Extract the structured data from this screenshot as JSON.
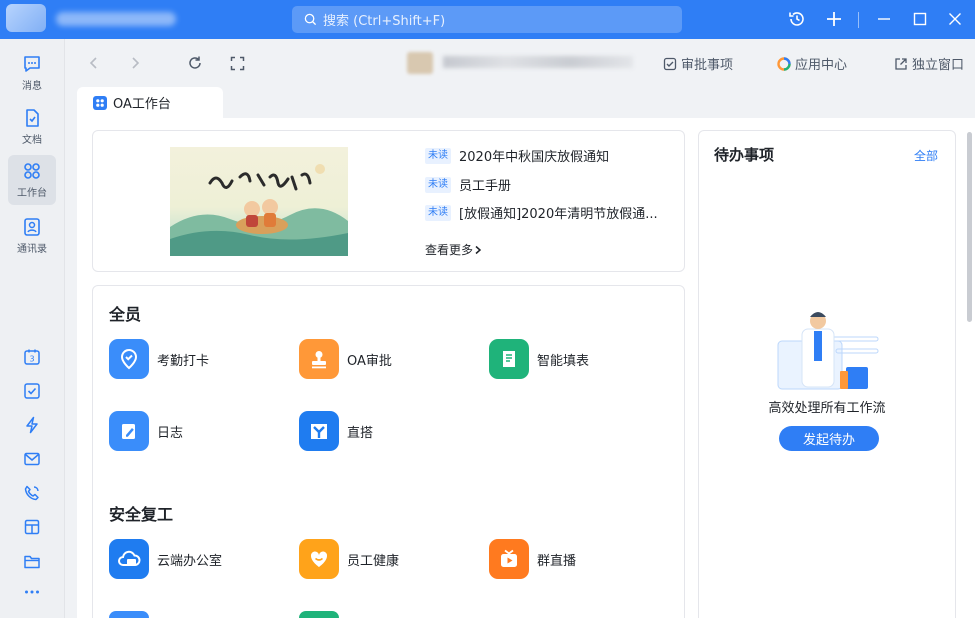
{
  "titlebar": {
    "search_placeholder": "搜索 (Ctrl+Shift+F)",
    "icons": [
      "history-icon",
      "plus-icon",
      "minimize-icon",
      "maximize-icon",
      "close-icon"
    ]
  },
  "rail": {
    "items": [
      {
        "label": "消息",
        "icon": "message-icon"
      },
      {
        "label": "文档",
        "icon": "document-icon"
      },
      {
        "label": "工作台",
        "icon": "workbench-icon",
        "active": true
      },
      {
        "label": "通讯录",
        "icon": "contacts-icon"
      }
    ],
    "bottom_icons": [
      "calendar-icon",
      "todo-check-icon",
      "lightning-icon",
      "mail-icon",
      "phone-icon",
      "box-icon",
      "folder-icon",
      "more-icon"
    ],
    "calendar_day": "3"
  },
  "nav": {
    "links": [
      {
        "label": "审批事项",
        "icon": "approval-check-icon"
      },
      {
        "label": "应用中心",
        "icon": "app-center-icon"
      },
      {
        "label": "独立窗口",
        "icon": "external-window-icon"
      }
    ]
  },
  "tab": {
    "label": "OA工作台"
  },
  "notices": {
    "items": [
      {
        "badge": "未读",
        "title": "2020年中秋国庆放假通知"
      },
      {
        "badge": "未读",
        "title": "员工手册"
      },
      {
        "badge": "未读",
        "title": "[放假通知]2020年清明节放假通..."
      }
    ],
    "more_label": "查看更多"
  },
  "sections": [
    {
      "title": "全员",
      "apps": [
        {
          "label": "考勤打卡",
          "icon": "location-icon",
          "color": "#3a8dfa"
        },
        {
          "label": "OA审批",
          "icon": "stamp-icon",
          "color": "#ff9838"
        },
        {
          "label": "智能填表",
          "icon": "form-icon",
          "color": "#1fb37a"
        },
        {
          "label": "日志",
          "icon": "journal-icon",
          "color": "#3a8dfa"
        },
        {
          "label": "直搭",
          "icon": "builder-icon",
          "color": "#1f7cf0"
        }
      ]
    },
    {
      "title": "安全复工",
      "apps": [
        {
          "label": "云端办公室",
          "icon": "cloud-office-icon",
          "color": "#1f7cf0"
        },
        {
          "label": "员工健康",
          "icon": "heart-icon",
          "color": "#ffa31a"
        },
        {
          "label": "群直播",
          "icon": "live-tv-icon",
          "color": "#ff7a1f"
        }
      ]
    }
  ],
  "todo": {
    "title": "待办事项",
    "all_label": "全部",
    "empty_text": "高效处理所有工作流",
    "button_label": "发起待办"
  },
  "colors": {
    "accent": "#2f7ef5",
    "rail_bg": "#eef0f3",
    "badge_bg": "#e8f1ff"
  }
}
